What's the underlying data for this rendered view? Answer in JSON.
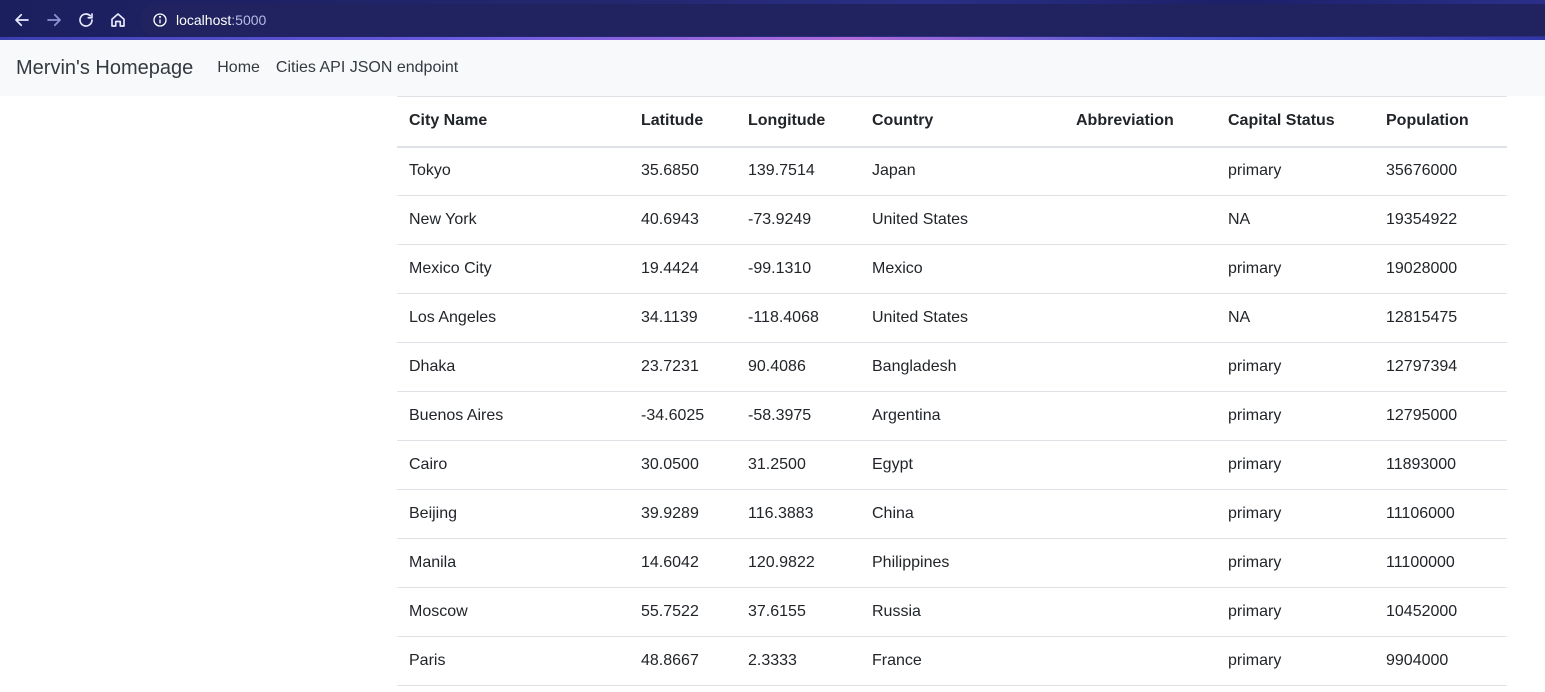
{
  "browser": {
    "address_host": "localhost",
    "address_port": ":5000"
  },
  "navbar": {
    "brand": "Mervin's Homepage",
    "links": [
      "Home",
      "Cities API JSON endpoint"
    ]
  },
  "table": {
    "headers": [
      "City Name",
      "Latitude",
      "Longitude",
      "Country",
      "Abbreviation",
      "Capital Status",
      "Population"
    ],
    "rows": [
      [
        "Tokyo",
        "35.6850",
        "139.7514",
        "Japan",
        "",
        "primary",
        "35676000"
      ],
      [
        "New York",
        "40.6943",
        "-73.9249",
        "United States",
        "",
        "NA",
        "19354922"
      ],
      [
        "Mexico City",
        "19.4424",
        "-99.1310",
        "Mexico",
        "",
        "primary",
        "19028000"
      ],
      [
        "Los Angeles",
        "34.1139",
        "-118.4068",
        "United States",
        "",
        "NA",
        "12815475"
      ],
      [
        "Dhaka",
        "23.7231",
        "90.4086",
        "Bangladesh",
        "",
        "primary",
        "12797394"
      ],
      [
        "Buenos Aires",
        "-34.6025",
        "-58.3975",
        "Argentina",
        "",
        "primary",
        "12795000"
      ],
      [
        "Cairo",
        "30.0500",
        "31.2500",
        "Egypt",
        "",
        "primary",
        "11893000"
      ],
      [
        "Beijing",
        "39.9289",
        "116.3883",
        "China",
        "",
        "primary",
        "11106000"
      ],
      [
        "Manila",
        "14.6042",
        "120.9822",
        "Philippines",
        "",
        "primary",
        "11100000"
      ],
      [
        "Moscow",
        "55.7522",
        "37.6155",
        "Russia",
        "",
        "primary",
        "10452000"
      ],
      [
        "Paris",
        "48.8667",
        "2.3333",
        "France",
        "",
        "primary",
        "9904000"
      ]
    ]
  }
}
